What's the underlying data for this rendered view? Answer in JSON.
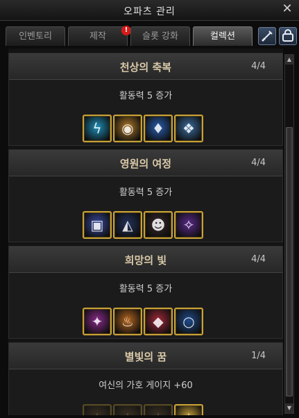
{
  "window": {
    "title": "오파츠 관리",
    "close_label": "✕"
  },
  "tabs": [
    {
      "label": "인벤토리",
      "active": false
    },
    {
      "label": "제작",
      "active": false,
      "alert": "!"
    },
    {
      "label": "슬롯 강화",
      "active": false
    },
    {
      "label": "컬렉션",
      "active": true
    }
  ],
  "toolbar": {
    "icons": [
      "sword-icon",
      "bag-icon"
    ]
  },
  "collections": [
    {
      "name": "천상의 축복",
      "progress": "4/4",
      "effect": "활동력 5 증가",
      "items": [
        {
          "icon": "lightning-orb-icon",
          "glyph": "ϟ",
          "color": "#1f8fb8",
          "owned": true
        },
        {
          "icon": "golden-stone-icon",
          "glyph": "◉",
          "color": "#b07a2a",
          "owned": true
        },
        {
          "icon": "blue-crystal-icon",
          "glyph": "♦",
          "color": "#2a5fb0",
          "owned": true
        },
        {
          "icon": "winged-gem-icon",
          "glyph": "❖",
          "color": "#3b6ea0",
          "owned": true
        }
      ]
    },
    {
      "name": "영원의 여정",
      "progress": "4/4",
      "effect": "활동력 5 증가",
      "items": [
        {
          "icon": "rune-tablet-icon",
          "glyph": "▣",
          "color": "#3a4aa0",
          "owned": true
        },
        {
          "icon": "hooded-figure-icon",
          "glyph": "◭",
          "color": "#24325a",
          "owned": true
        },
        {
          "icon": "dark-mask-icon",
          "glyph": "☻",
          "color": "#3a2a2a",
          "owned": true
        },
        {
          "icon": "violet-shard-icon",
          "glyph": "✧",
          "color": "#5a2a8a",
          "owned": true
        }
      ]
    },
    {
      "name": "희망의 빛",
      "progress": "4/4",
      "effect": "활동력 5 증가",
      "items": [
        {
          "icon": "pink-star-gem-icon",
          "glyph": "✦",
          "color": "#8a2a8a",
          "owned": true
        },
        {
          "icon": "amber-flame-icon",
          "glyph": "♨",
          "color": "#b5661f",
          "owned": true
        },
        {
          "icon": "ruby-gem-icon",
          "glyph": "◆",
          "color": "#a02a3a",
          "owned": true
        },
        {
          "icon": "sapphire-ring-icon",
          "glyph": "○",
          "color": "#1f4a8a",
          "owned": true
        }
      ]
    },
    {
      "name": "별빛의 꿈",
      "progress": "1/4",
      "effect": "여신의 가호 게이지 +60",
      "items": [
        {
          "icon": "star-relic-1-icon",
          "glyph": "✶",
          "color": "#7a5a2a",
          "owned": false
        },
        {
          "icon": "star-relic-2-icon",
          "glyph": "✶",
          "color": "#7a5a2a",
          "owned": false
        },
        {
          "icon": "star-relic-3-icon",
          "glyph": "✶",
          "color": "#7a5a2a",
          "owned": false
        },
        {
          "icon": "star-relic-4-icon",
          "glyph": "✶",
          "color": "#c9a239",
          "owned": true
        }
      ]
    }
  ],
  "colors": {
    "accent_gold": "#c9a239",
    "title_text": "#d9c9a8",
    "alert_red": "#d61a1a"
  }
}
